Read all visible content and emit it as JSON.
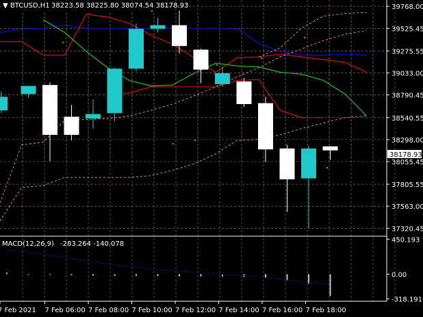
{
  "header": {
    "symbol": "BTCUSD,H1",
    "ohlc": "38223.58 38225.80 38074.54 38178.93"
  },
  "macd_header": {
    "label": "MACD(12,26,9)",
    "values": "-283.264 -140.078"
  },
  "current_price_label": "38178.93",
  "colors": {
    "background": "#000000",
    "grid": "#c0c0c0",
    "bull_candle": "#20c8c8",
    "bear_candle": "#ffffff",
    "ma_blue": "#1010c8",
    "ma_red": "#d01010",
    "ma_green": "#20c020",
    "envelope": "#e8a070",
    "period_separator": "#e8a070",
    "macd_hist": "#c0c0c0",
    "macd_signal": "#1818a0",
    "dots": "#20c020"
  },
  "chart_data": {
    "type": "candlestick",
    "price_axis_ticks": [
      "39768.00",
      "39525.45",
      "39275.55",
      "39033.00",
      "38790.45",
      "38540.55",
      "38298.00",
      "38055.45",
      "37805.55",
      "37563.00",
      "37320.45"
    ],
    "time_axis_ticks": [
      "7 Feb 2021",
      "7 Feb 06:00",
      "7 Feb 08:00",
      "7 Feb 10:00",
      "7 Feb 12:00",
      "7 Feb 14:00",
      "7 Feb 16:00",
      "7 Feb 18:00"
    ],
    "ylim": [
      37270,
      39800
    ],
    "candles": [
      {
        "o": 38620,
        "h": 38830,
        "c": 38770,
        "l": 38590
      },
      {
        "o": 38800,
        "h": 38870,
        "c": 38890,
        "l": 38760
      },
      {
        "o": 38900,
        "h": 38930,
        "c": 38350,
        "l": 38060
      },
      {
        "o": 38550,
        "h": 38680,
        "c": 38350,
        "l": 38290
      },
      {
        "o": 38530,
        "h": 38740,
        "c": 38580,
        "l": 38420
      },
      {
        "o": 38590,
        "h": 39090,
        "c": 39080,
        "l": 38500
      },
      {
        "o": 39080,
        "h": 39580,
        "c": 39520,
        "l": 39050
      },
      {
        "o": 39520,
        "h": 39640,
        "c": 39560,
        "l": 39480
      },
      {
        "o": 39560,
        "h": 39720,
        "c": 39330,
        "l": 39250
      },
      {
        "o": 39290,
        "h": 39300,
        "c": 39070,
        "l": 38920
      },
      {
        "o": 38910,
        "h": 39100,
        "c": 39030,
        "l": 38880
      },
      {
        "o": 38940,
        "h": 38980,
        "c": 38690,
        "l": 38660
      },
      {
        "o": 38700,
        "h": 38770,
        "c": 38190,
        "l": 38050
      },
      {
        "o": 38200,
        "h": 38240,
        "c": 37860,
        "l": 37500
      },
      {
        "o": 37870,
        "h": 38230,
        "c": 38200,
        "l": 37320
      },
      {
        "o": 38223.58,
        "h": 38225.8,
        "c": 38178.93,
        "l": 38074.54
      }
    ],
    "indicator_lines": [
      {
        "name": "blue",
        "color": "#1010c8",
        "values": [
          39480,
          39520,
          39525,
          39560,
          39525,
          39525,
          39525,
          39525,
          39525,
          39525,
          39525,
          39520,
          39360,
          39270,
          39230,
          39230,
          39240,
          39230
        ]
      },
      {
        "name": "red",
        "color": "#d01010",
        "values": [
          39380,
          39380,
          39230,
          39230,
          39680,
          39650,
          39580,
          39450,
          39350,
          39200,
          39040,
          39200,
          39210,
          39240,
          39210,
          39180,
          39150,
          39040
        ]
      },
      {
        "name": "green",
        "color": "#20c020",
        "values": [
          null,
          null,
          39620,
          39480,
          39270,
          39090,
          38950,
          38890,
          38900,
          39030,
          39140,
          39110,
          39100,
          39040,
          39020,
          38950,
          38800,
          38560
        ]
      },
      {
        "name": "red_lower",
        "color": "#d01010",
        "values": [
          null,
          null,
          null,
          null,
          null,
          38810,
          38810,
          38880,
          38880,
          38880,
          38880,
          38950,
          38960,
          38620,
          38540,
          38540,
          null,
          null
        ]
      },
      {
        "name": "env_upper",
        "color": "#e8a070",
        "dashed": true,
        "values": [
          null,
          null,
          null,
          null,
          null,
          null,
          null,
          null,
          null,
          null,
          null,
          null,
          39210,
          39310,
          39530,
          39660,
          39690,
          39700
        ]
      },
      {
        "name": "env_lower",
        "color": "#e8a070",
        "dashed": true,
        "values": [
          37600,
          38240,
          38270,
          38510,
          38520,
          38530,
          38560,
          38620,
          38690,
          38780,
          38880,
          38990,
          39090,
          39210,
          39300,
          39390,
          39460,
          39500
        ]
      },
      {
        "name": "env_bottom",
        "color": "#e8a070",
        "dashed": true,
        "values": [
          37400,
          37770,
          37790,
          37880,
          37880,
          37880,
          37880,
          37900,
          37960,
          38030,
          38140,
          38290,
          38300,
          38350,
          38420,
          38480,
          38540,
          38560
        ]
      }
    ],
    "macd": {
      "ylim": [
        -350,
        480
      ],
      "axis_ticks": [
        "450.193",
        "0.00",
        "-318.191"
      ],
      "hist": [
        20,
        -10,
        -10,
        -15,
        -20,
        -22,
        -22,
        -25,
        -28,
        -30,
        -30,
        -35,
        -45,
        -80,
        -120,
        -283.264
      ],
      "signal": [
        310,
        285,
        245,
        200,
        160,
        120,
        90,
        60,
        40,
        15,
        -5,
        -20,
        -45,
        -75,
        -100,
        -140.078
      ]
    }
  }
}
